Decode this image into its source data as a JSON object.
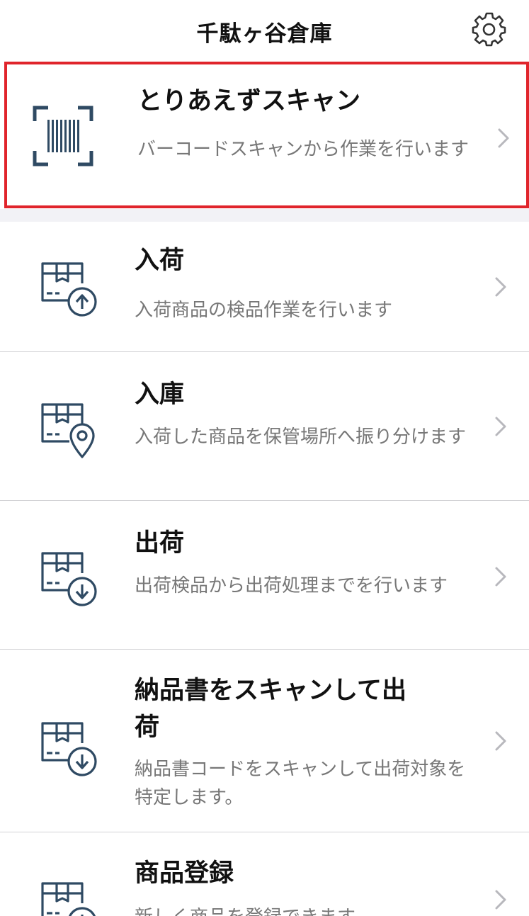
{
  "header": {
    "title": "千駄ヶ谷倉庫",
    "settings_icon": "gear-icon"
  },
  "featured": {
    "title": "とりあえずスキャン",
    "subtitle": "バーコードスキャンから作業を行います",
    "icon": "barcode-scan-icon"
  },
  "menu": [
    {
      "title": "入荷",
      "subtitle": "入荷商品の検品作業を行います",
      "icon": "box-upload-icon"
    },
    {
      "title": "入庫",
      "subtitle": "入荷した商品を保管場所へ振り分けます",
      "icon": "box-location-icon"
    },
    {
      "title": "出荷",
      "subtitle": "出荷検品から出荷処理までを行います",
      "icon": "box-download-icon"
    },
    {
      "title": "納品書をスキャンして出荷",
      "subtitle": "納品書コードをスキャンして出荷対象を特定します。",
      "icon": "box-download-icon"
    },
    {
      "title": "商品登録",
      "subtitle": "新しく商品を登録できます",
      "icon": "box-add-icon"
    }
  ],
  "colors": {
    "highlight_border": "#e0242b",
    "icon": "#2f4a63",
    "subtitle": "#777777",
    "divider": "#d3d3d6"
  }
}
